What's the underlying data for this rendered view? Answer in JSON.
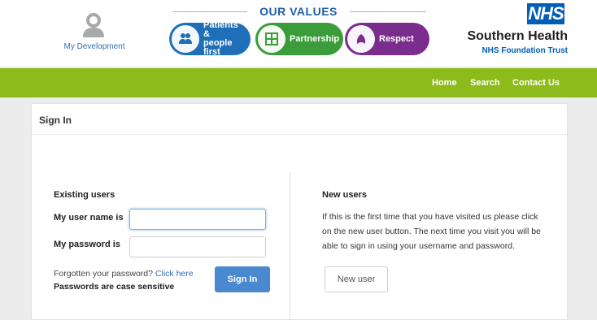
{
  "header": {
    "my_development": "My Development",
    "values_title": "OUR VALUES",
    "values": [
      {
        "label_line1": "Patients &",
        "label_line2": "people first",
        "color": "#1e6fb8",
        "icon": "people-icon"
      },
      {
        "label_line1": "Partnership",
        "label_line2": "",
        "color": "#3a9d3a",
        "icon": "puzzle-icon"
      },
      {
        "label_line1": "Respect",
        "label_line2": "",
        "color": "#7a2d8c",
        "icon": "respect-icon"
      }
    ],
    "nhs_logo": "NHS",
    "org_name": "Southern Health",
    "org_sub": "NHS Foundation Trust"
  },
  "nav": {
    "items": [
      "Home",
      "Search",
      "Contact Us"
    ],
    "bar_color": "#8dbb1c"
  },
  "signin": {
    "title": "Sign In",
    "existing_heading": "Existing users",
    "username_label": "My user name is",
    "username_value": "",
    "password_label": "My password is",
    "password_value": "",
    "forgot_text": "Forgotten your password?",
    "forgot_link": "Click here",
    "case_note": "Passwords are case sensitive",
    "signin_button": "Sign In",
    "new_heading": "New users",
    "new_text": "If this is the first time that you have visited us please click on the new user button. The next time you visit you will be able to sign in using your username and password.",
    "new_button": "New user"
  }
}
